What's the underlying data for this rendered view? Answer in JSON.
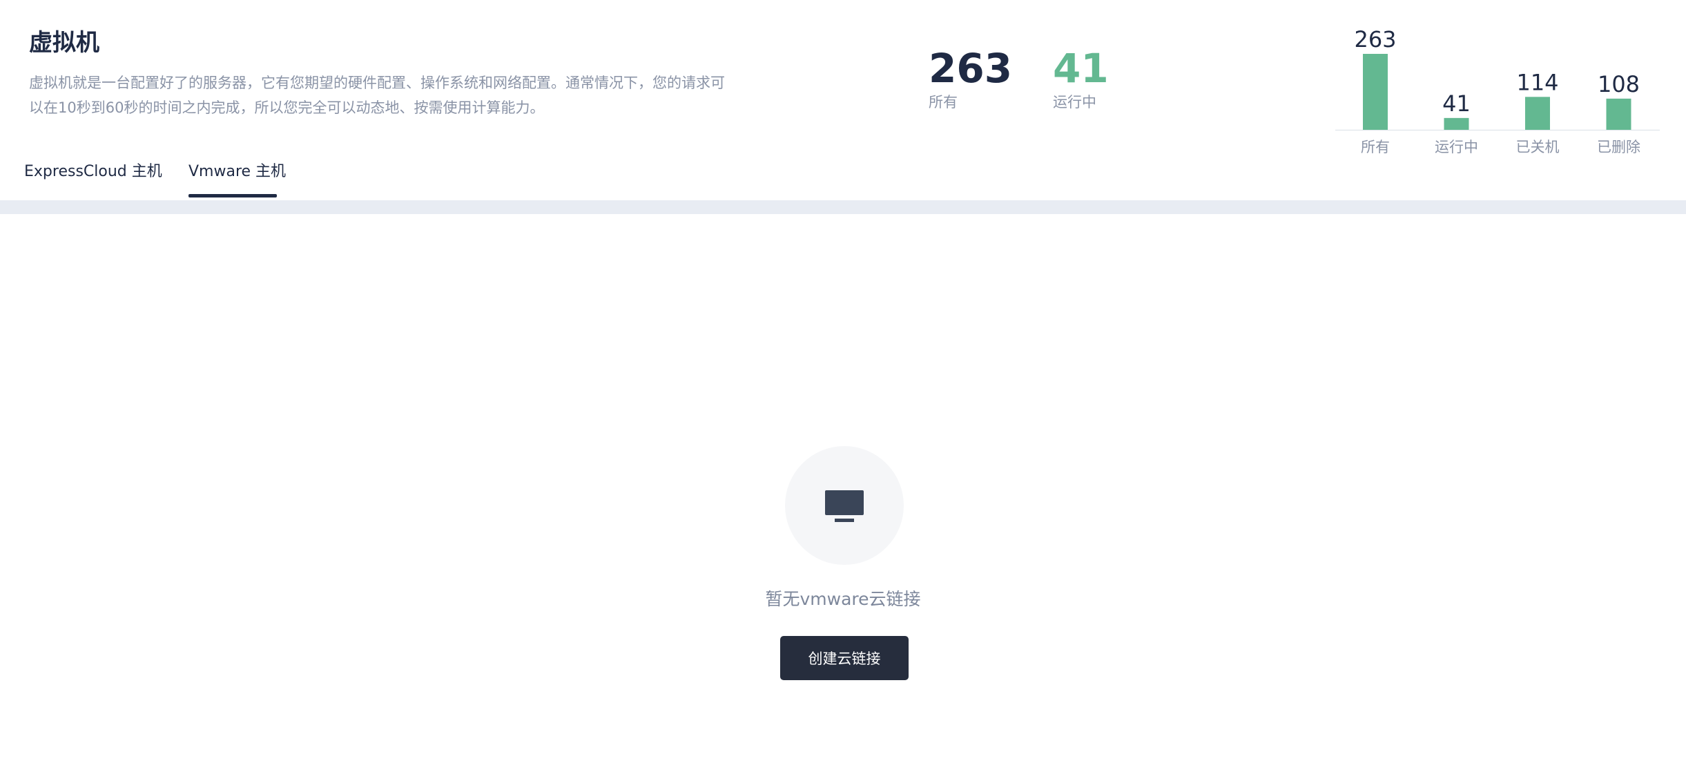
{
  "header": {
    "title": "虚拟机",
    "description": "虚拟机就是一台配置好了的服务器，它有您期望的硬件配置、操作系统和网络配置。通常情况下，您的请求可以在10秒到60秒的时间之内完成，所以您完全可以动态地、按需使用计算能力。"
  },
  "stats": {
    "all": {
      "value": "263",
      "label": "所有"
    },
    "running": {
      "value": "41",
      "label": "运行中"
    }
  },
  "tabs": [
    {
      "label": "ExpressCloud 主机",
      "active": false
    },
    {
      "label": "Vmware 主机",
      "active": true
    }
  ],
  "empty_state": {
    "icon": "monitor-icon",
    "message": "暂无vmware云链接",
    "button_label": "创建云链接"
  },
  "colors": {
    "accent_green": "#63b891",
    "dark": "#1f2a44",
    "button_bg": "#262d3d"
  },
  "chart_data": {
    "type": "bar",
    "categories": [
      "所有",
      "运行中",
      "已关机",
      "已删除"
    ],
    "values": [
      263,
      41,
      114,
      108
    ],
    "data_labels": [
      "263",
      "41",
      "114",
      "108"
    ],
    "ylim": [
      0,
      263
    ],
    "grid": false,
    "legend": "none",
    "bar_color": "#63b891"
  }
}
